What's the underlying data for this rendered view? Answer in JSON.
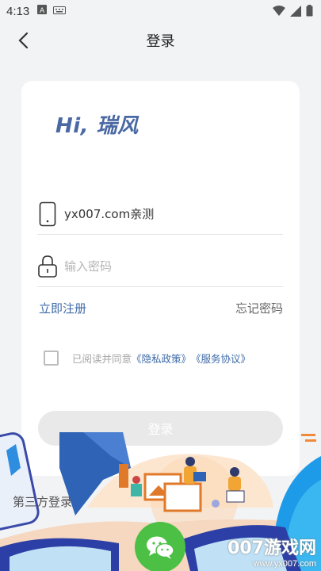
{
  "status_bar": {
    "time": "4:13"
  },
  "nav": {
    "title": "登录"
  },
  "brand": {
    "greeting": "Hi, 瑞风"
  },
  "form": {
    "phone_value": "yx007.com亲测",
    "password_placeholder": "输入密码"
  },
  "links": {
    "register": "立即注册",
    "forgot": "忘记密码"
  },
  "agreement": {
    "prefix": "已阅读并同意",
    "privacy": "《隐私政策》",
    "service": "《服务协议》"
  },
  "login_button": "登录",
  "third_party": {
    "label": "第三方登录"
  },
  "watermark": {
    "logo": "007游戏网",
    "url": "www.yx007.com"
  },
  "colors": {
    "accent": "#3d6aa8",
    "wechat": "#4cc045",
    "background": "#f2f3f5"
  }
}
